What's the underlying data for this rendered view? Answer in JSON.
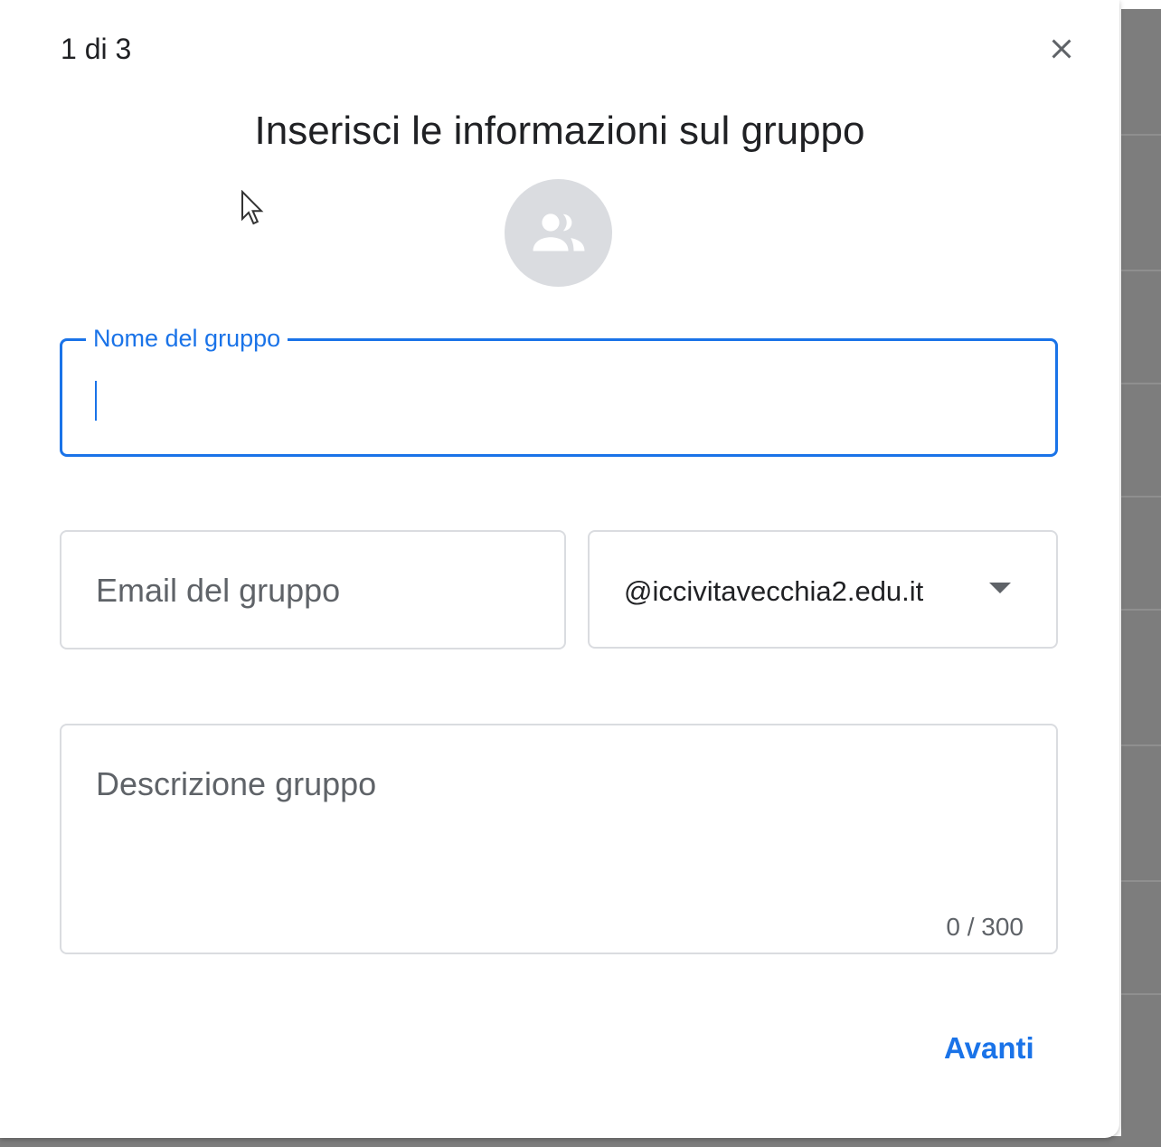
{
  "dialog": {
    "step": "1 di 3",
    "title": "Inserisci le informazioni sul gruppo",
    "close_icon": "close-icon",
    "avatar_icon": "group-icon"
  },
  "form": {
    "name": {
      "label": "Nome del gruppo",
      "value": ""
    },
    "email": {
      "placeholder": "Email del gruppo",
      "value": ""
    },
    "domain": {
      "selected": "@iccivitavecchia2.edu.it"
    },
    "description": {
      "placeholder": "Descrizione gruppo",
      "counter": "0 / 300"
    }
  },
  "actions": {
    "next_label": "Avanti"
  },
  "colors": {
    "accent": "#1a73e8",
    "border": "#dadce0",
    "text": "#202124",
    "muted": "#5f6368"
  }
}
